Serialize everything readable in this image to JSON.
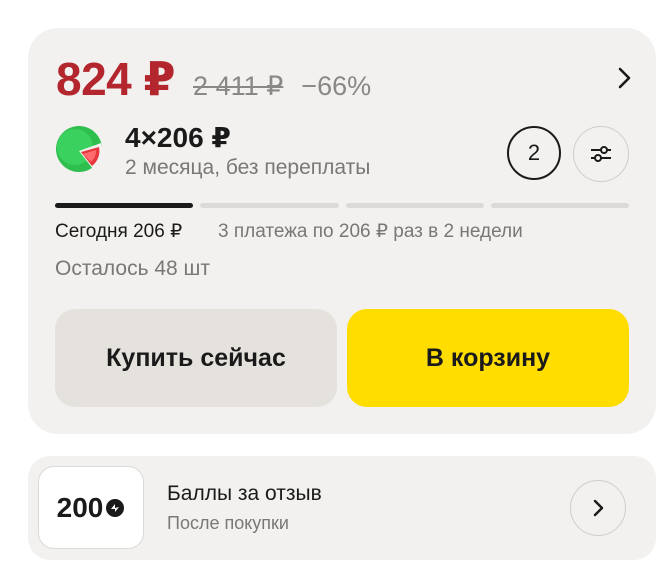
{
  "offer": {
    "price_current": "824 ₽",
    "price_old": "2 411 ₽",
    "discount": "−66%"
  },
  "split": {
    "icon": "split-payment-logo-icon",
    "installment": "4×206 ₽",
    "subtitle": "2 месяца, без переплаты",
    "quantity": "2",
    "payments_total": 4,
    "payments_done": 1,
    "today_label": "Сегодня 206 ₽",
    "schedule_label": "3 платежа по 206 ₽ раз в 2 недели"
  },
  "stock_label": "Осталось 48 шт",
  "actions": {
    "buy_now": "Купить сейчас",
    "add_to_cart": "В корзину"
  },
  "review_bonus": {
    "points": "200",
    "title": "Баллы за отзыв",
    "subtitle": "После покупки"
  },
  "colors": {
    "price": "#b3262d",
    "cart_button": "#ffdd00",
    "buy_button": "#e5e2dd",
    "card_background": "#f2f1ef"
  }
}
